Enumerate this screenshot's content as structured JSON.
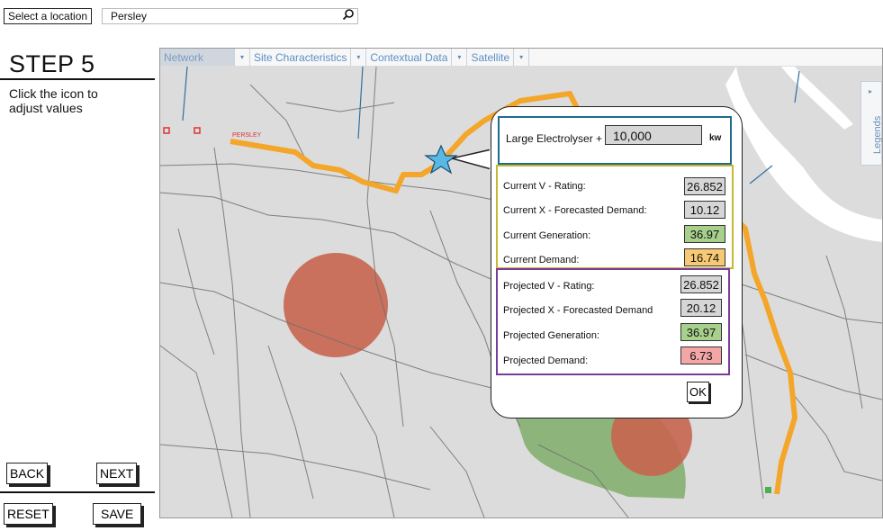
{
  "location": {
    "label": "Select a location",
    "value": "Persley",
    "search_icon": "search-icon"
  },
  "step": {
    "title": "STEP 5",
    "description": "Click the icon to adjust values"
  },
  "nav": {
    "back": "BACK",
    "next": "NEXT",
    "reset": "RESET",
    "save": "SAVE"
  },
  "map": {
    "tabs": [
      "Network",
      "Site Characteristics",
      "Contextual Data",
      "Satellite"
    ],
    "legends_label": "Legends",
    "place_label": "PERSLEY",
    "colors": {
      "route": "#f4a62a",
      "circle": "#c8654f",
      "green_area": "#7fae6a",
      "river": "#ffffff",
      "background": "#dcdcdc",
      "star": "#5ab8e3"
    }
  },
  "panel": {
    "electrolyser_label": "Large Electrolyser +",
    "electrolyser_value": "10,000",
    "electrolyser_unit": "kw",
    "current": {
      "v_label": "Current V - Rating:",
      "v_value": "26.852",
      "x_label": "Current X - Forecasted Demand:",
      "x_value": "10.12",
      "gen_label": "Current Generation:",
      "gen_value": "36.97",
      "demand_label": "Current Demand:",
      "demand_value": "16.74"
    },
    "projected": {
      "v_label": "Projected V - Rating:",
      "v_value": "26.852",
      "x_label": "Projected X - Forecasted Demand",
      "x_value": "20.12",
      "gen_label": "Projected Generation:",
      "gen_value": "36.97",
      "demand_label": "Projected Demand:",
      "demand_value": "6.73"
    },
    "ok": "OK",
    "colors": {
      "top_border": "#1f6b8c",
      "current_border": "#c8b734",
      "projected_border": "#7a3c9a",
      "neutral_fill": "#d6d6d6",
      "green_fill": "#a8d08d",
      "orange_fill": "#f7c975",
      "red_fill": "#f4a6a6"
    }
  }
}
